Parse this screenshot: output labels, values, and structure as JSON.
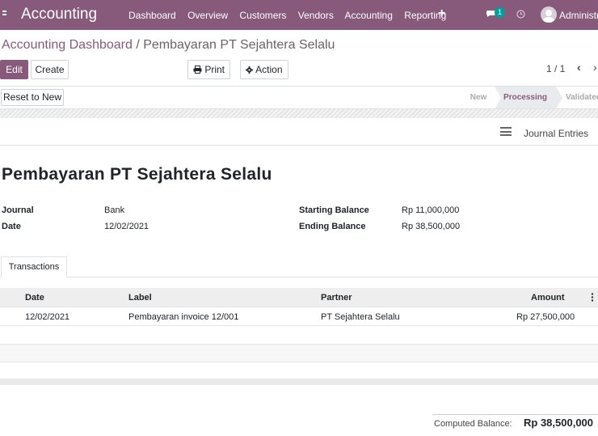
{
  "navbar": {
    "app_name": "Accounting",
    "menu": [
      "Dashboard",
      "Overview",
      "Customers",
      "Vendors",
      "Accounting",
      "Reporting"
    ],
    "plus": "+",
    "message_count": "1",
    "user_name": "Administrator",
    "color": "#875a7b"
  },
  "breadcrumb": {
    "parent": "Accounting Dashboard",
    "separator": " / ",
    "current": "Pembayaran PT Sejahtera Selalu"
  },
  "buttons": {
    "edit": "Edit",
    "create": "Create",
    "print": "Print",
    "action": "Action"
  },
  "pager": {
    "value": "1 / 1"
  },
  "statusbar": {
    "reset": "Reset to New",
    "stages": [
      "New",
      "Processing",
      "Validated"
    ],
    "active_stage": "Processing"
  },
  "smart_button": "Journal Entries",
  "record": {
    "title": "Pembayaran PT Sejahtera Selalu",
    "journal_label": "Journal",
    "journal": "Bank",
    "date_label": "Date",
    "date": "12/02/2021",
    "starting_balance_label": "Starting Balance",
    "starting_balance": "Rp 11,000,000",
    "ending_balance_label": "Ending Balance",
    "ending_balance": "Rp 38,500,000"
  },
  "tabs": [
    "Transactions"
  ],
  "table": {
    "columns": [
      "Date",
      "Label",
      "Partner",
      "Amount"
    ],
    "rows": [
      {
        "date": "12/02/2021",
        "label": "Pembayaran invoice 12/001",
        "partner": "PT Sejahtera Selalu",
        "amount": "Rp 27,500,000"
      }
    ]
  },
  "computed_balance": {
    "label": "Computed Balance:",
    "value": "Rp 38,500,000"
  }
}
